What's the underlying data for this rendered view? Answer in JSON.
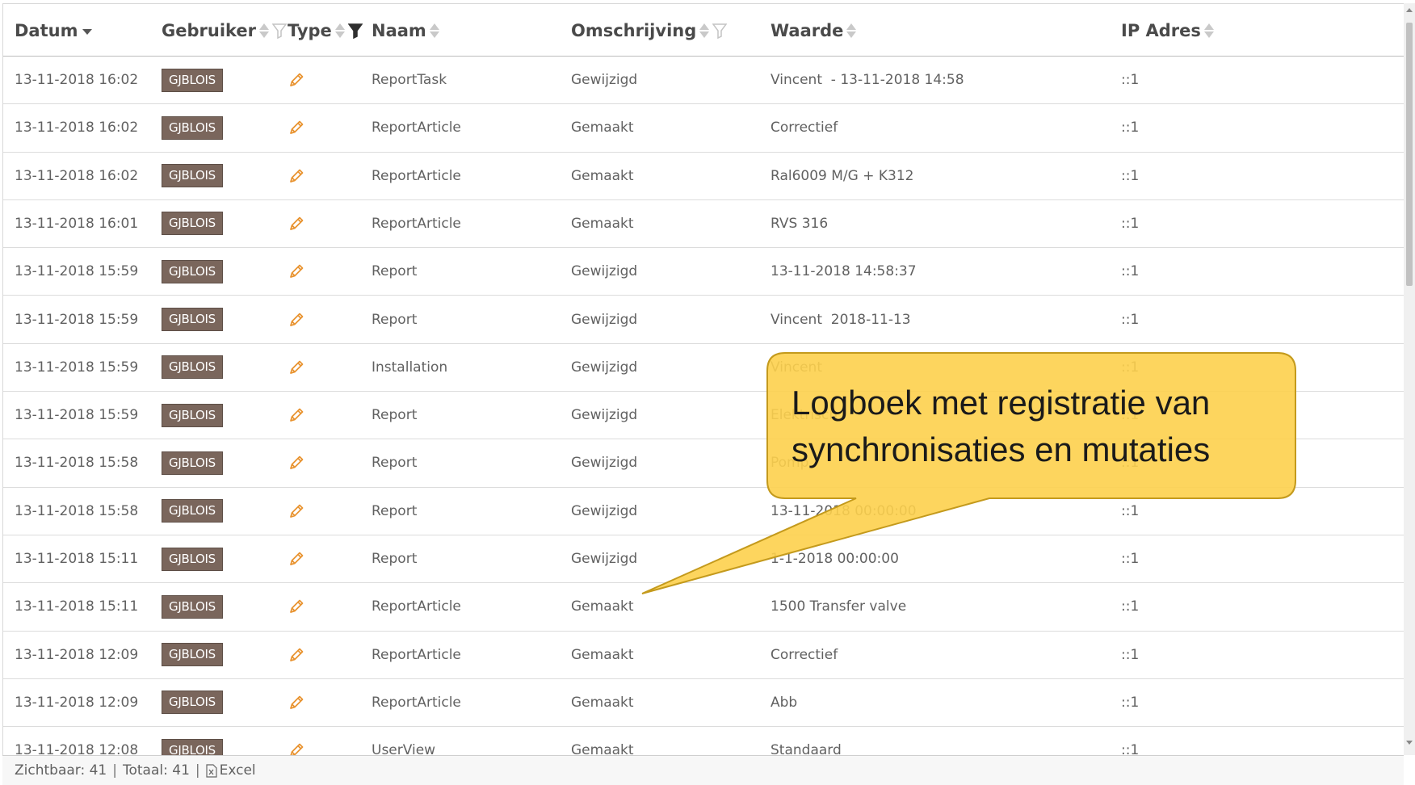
{
  "header": {
    "columns": [
      {
        "key": "datum",
        "label": "Datum"
      },
      {
        "key": "gebruiker",
        "label": "Gebruiker"
      },
      {
        "key": "type",
        "label": "Type"
      },
      {
        "key": "naam",
        "label": "Naam"
      },
      {
        "key": "omschrijving",
        "label": "Omschrijving"
      },
      {
        "key": "waarde",
        "label": "Waarde"
      },
      {
        "key": "ip",
        "label": "IP Adres"
      }
    ]
  },
  "icons": {
    "type_cell": "pencil-icon",
    "sort": "sort-icon",
    "filter": "filter-icon",
    "filter_active": "filter-active-icon",
    "export": "excel-icon"
  },
  "colors": {
    "badge_bg": "#7a665c",
    "pencil": "#e8922e",
    "callout_fill": "#fdd04c",
    "callout_stroke": "#c49a1c"
  },
  "rows": [
    {
      "datum": "13-11-2018 16:02",
      "gebruiker": "GJBLOIS",
      "naam": "ReportTask",
      "omschrijving": "Gewijzigd",
      "waarde": "Vincent  - 13-11-2018 14:58",
      "ip": "::1"
    },
    {
      "datum": "13-11-2018 16:02",
      "gebruiker": "GJBLOIS",
      "naam": "ReportArticle",
      "omschrijving": "Gemaakt",
      "waarde": "Correctief",
      "ip": "::1"
    },
    {
      "datum": "13-11-2018 16:02",
      "gebruiker": "GJBLOIS",
      "naam": "ReportArticle",
      "omschrijving": "Gemaakt",
      "waarde": "Ral6009 M/G + K312",
      "ip": "::1"
    },
    {
      "datum": "13-11-2018 16:01",
      "gebruiker": "GJBLOIS",
      "naam": "ReportArticle",
      "omschrijving": "Gemaakt",
      "waarde": "RVS 316",
      "ip": "::1"
    },
    {
      "datum": "13-11-2018 15:59",
      "gebruiker": "GJBLOIS",
      "naam": "Report",
      "omschrijving": "Gewijzigd",
      "waarde": "13-11-2018 14:58:37",
      "ip": "::1"
    },
    {
      "datum": "13-11-2018 15:59",
      "gebruiker": "GJBLOIS",
      "naam": "Report",
      "omschrijving": "Gewijzigd",
      "waarde": "Vincent  2018-11-13",
      "ip": "::1"
    },
    {
      "datum": "13-11-2018 15:59",
      "gebruiker": "GJBLOIS",
      "naam": "Installation",
      "omschrijving": "Gewijzigd",
      "waarde": "Vincent",
      "ip": "::1"
    },
    {
      "datum": "13-11-2018 15:59",
      "gebruiker": "GJBLOIS",
      "naam": "Report",
      "omschrijving": "Gewijzigd",
      "waarde": "Elektrisch",
      "ip": "::1"
    },
    {
      "datum": "13-11-2018 15:58",
      "gebruiker": "GJBLOIS",
      "naam": "Report",
      "omschrijving": "Gewijzigd",
      "waarde": "Pomp",
      "ip": "::1"
    },
    {
      "datum": "13-11-2018 15:58",
      "gebruiker": "GJBLOIS",
      "naam": "Report",
      "omschrijving": "Gewijzigd",
      "waarde": "13-11-2018 00:00:00",
      "ip": "::1"
    },
    {
      "datum": "13-11-2018 15:11",
      "gebruiker": "GJBLOIS",
      "naam": "Report",
      "omschrijving": "Gewijzigd",
      "waarde": "1-1-2018 00:00:00",
      "ip": "::1"
    },
    {
      "datum": "13-11-2018 15:11",
      "gebruiker": "GJBLOIS",
      "naam": "ReportArticle",
      "omschrijving": "Gemaakt",
      "waarde": "1500 Transfer valve",
      "ip": "::1"
    },
    {
      "datum": "13-11-2018 12:09",
      "gebruiker": "GJBLOIS",
      "naam": "ReportArticle",
      "omschrijving": "Gemaakt",
      "waarde": "Correctief",
      "ip": "::1"
    },
    {
      "datum": "13-11-2018 12:09",
      "gebruiker": "GJBLOIS",
      "naam": "ReportArticle",
      "omschrijving": "Gemaakt",
      "waarde": "Abb",
      "ip": "::1"
    },
    {
      "datum": "13-11-2018 12:08",
      "gebruiker": "GJBLOIS",
      "naam": "UserView",
      "omschrijving": "Gemaakt",
      "waarde": "Standaard",
      "ip": "::1"
    }
  ],
  "footer": {
    "visible_label": "Zichtbaar:",
    "visible_count": "41",
    "total_label": "Totaal:",
    "total_count": "41",
    "separator": "|",
    "excel_label": "Excel"
  },
  "callout": {
    "line1": "Logboek met registratie van",
    "line2": "synchronisaties en mutaties"
  }
}
